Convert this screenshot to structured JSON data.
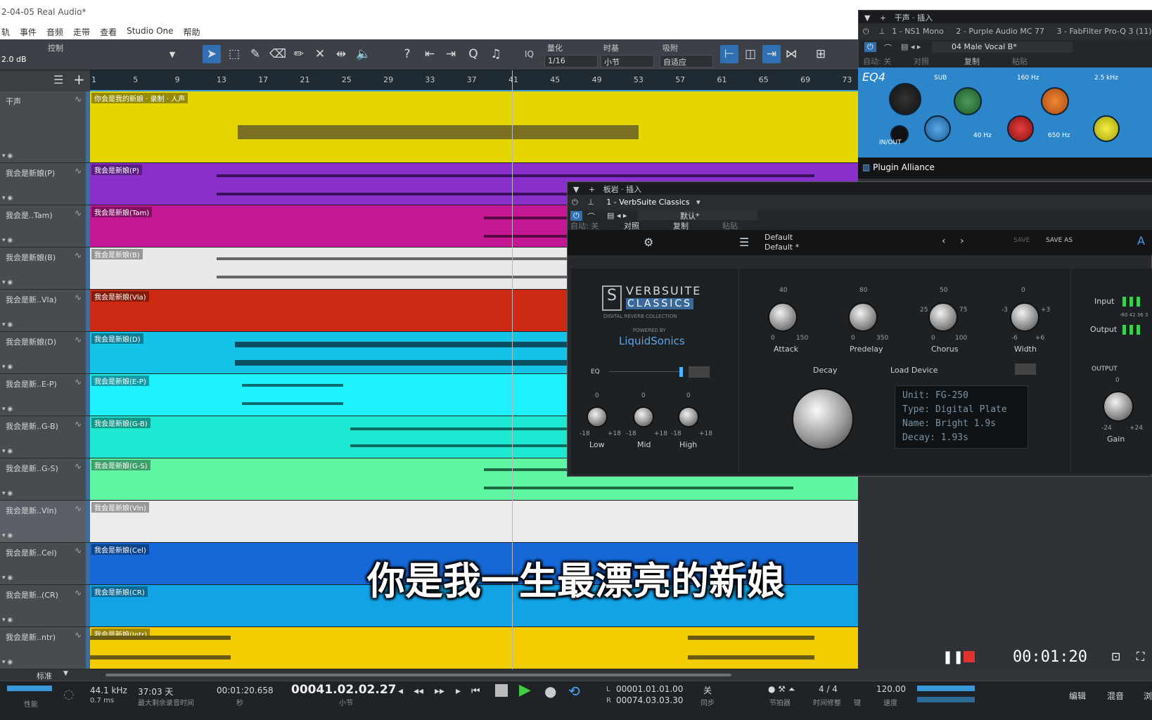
{
  "window": {
    "title": "2-04-05 Real Audio*"
  },
  "menu": [
    "轨",
    "事件",
    "音频",
    "走带",
    "查看",
    "Studio One",
    "帮助"
  ],
  "toolbar": {
    "master_label": "控制",
    "volume": "2.0 dB",
    "quantize_label": "量化",
    "quantize_value": "1/16",
    "timebase_label": "时基",
    "timebase_value": "小节",
    "snap_label": "吸附",
    "snap_value": "自适应",
    "iq": "IQ"
  },
  "ruler": {
    "ticks": [
      "1",
      "5",
      "9",
      "13",
      "17",
      "21",
      "25",
      "29",
      "33",
      "37",
      "41",
      "45",
      "49",
      "53",
      "57",
      "61",
      "65",
      "69",
      "73"
    ]
  },
  "tracks": [
    {
      "name": "干声",
      "clip": "你会是我的新娘 · 录制 · 人声",
      "color": "#e6d600",
      "wave": "#7a6f20"
    },
    {
      "name": "我会是新娘(P)",
      "clip": "我会是新娘(P)",
      "color": "#8a2fc9",
      "wave": "#3a0f5c"
    },
    {
      "name": "我会是..Tam)",
      "clip": "我会是新娘(Tam)",
      "color": "#c51795",
      "wave": "#5a0a42"
    },
    {
      "name": "我会是新娘(B)",
      "clip": "我会是新娘(B)",
      "color": "#e8e8e8",
      "wave": "#666666"
    },
    {
      "name": "我会是新..Vla)",
      "clip": "我会是新娘(Vla)",
      "color": "#cc2a12",
      "wave": "#5a1006"
    },
    {
      "name": "我会是新娘(D)",
      "clip": "我会是新娘(D)",
      "color": "#13c4e8",
      "wave": "#0a4e62"
    },
    {
      "name": "我会是新..E-P)",
      "clip": "我会是新娘(E-P)",
      "color": "#1ef2ff",
      "wave": "#0b6a72"
    },
    {
      "name": "我会是新..G-B)",
      "clip": "我会是新娘(G-B)",
      "color": "#1ee8d2",
      "wave": "#0b6a60"
    },
    {
      "name": "我会是新..G-S)",
      "clip": "我会是新娘(G-S)",
      "color": "#5ff5a2",
      "wave": "#1e6a40"
    },
    {
      "name": "我会是新..Vln)",
      "clip": "我会是新娘(Vln)",
      "color": "#ececec",
      "wave": "#777777"
    },
    {
      "name": "我会是新..Cel)",
      "clip": "我会是新娘(Cel)",
      "color": "#1568d6",
      "wave": "#0a2e62"
    },
    {
      "name": "我会是新..(CR)",
      "clip": "我会是新娘(CR)",
      "color": "#12a2e6",
      "wave": "#0a4c6a"
    },
    {
      "name": "我会是新..ntr)",
      "clip": "我会是新娘(Intr)",
      "color": "#f0cc00",
      "wave": "#6a5a10"
    }
  ],
  "subtitle": "你是我一生最漂亮的新娘",
  "eq_window": {
    "title": "干声 · 插入",
    "slots": [
      "1 - NS1 Mono",
      "2 - Purple Audio MC 77",
      "3 - FabFilter Pro-Q 3 (11)"
    ],
    "preset": "04 Male Vocal B*",
    "auto": "自动: 关",
    "compare": "对照",
    "copy": "复制",
    "paste": "粘贴",
    "plugin_name": "EQ4",
    "bands": [
      "SUB",
      "160 Hz",
      "2.5 kHz",
      "40 Hz",
      "650 Hz"
    ],
    "inout": "IN/OUT",
    "vendor": "Plugin Alliance"
  },
  "verb_window": {
    "title": "板岩 · 插入",
    "slot": "1 - VerbSuite Classics",
    "preset_sel": "默认*",
    "auto": "自动: 关",
    "compare": "对照",
    "copy": "复制",
    "paste": "粘贴",
    "preset_line1": "Default",
    "preset_line2": "Default *",
    "save": "SAVE",
    "save_as": "SAVE AS",
    "brand_line1": "VERBSUITE",
    "brand_line2": "CLASSICS",
    "brand_sub": "DIGITAL REVERB COLLECTION",
    "powered": "POWERED BY",
    "vendor": "LiquidSonics",
    "knobs": [
      {
        "label": "Attack",
        "top": "40",
        "min": "0",
        "max": "150"
      },
      {
        "label": "Predelay",
        "top": "80",
        "min": "0",
        "max": "350"
      },
      {
        "label": "Chorus",
        "top": "50",
        "min": "0",
        "max": "100"
      },
      {
        "label": "Width",
        "top": "0",
        "min": "-6",
        "max": "+6"
      }
    ],
    "eq_label": "EQ",
    "eq_knobs": [
      {
        "label": "Low",
        "top": "0",
        "min": "-18",
        "max": "+18"
      },
      {
        "label": "Mid",
        "top": "0",
        "min": "-18",
        "max": "+18"
      },
      {
        "label": "High",
        "top": "0",
        "min": "-18",
        "max": "+18"
      }
    ],
    "decay_label": "Decay",
    "load_device": "Load Device",
    "lcd": [
      "Unit:  FG-250",
      "Type:  Digital Plate",
      "Name:  Bright 1.9s",
      "Decay:  1.93s"
    ],
    "input": "Input",
    "output": "Output",
    "output_section": "OUTPUT",
    "gain": "Gain",
    "gain_top": "0",
    "gain_min": "-24",
    "gain_max": "+24",
    "width_left": "-3",
    "width_right": "+3",
    "chorus_left": "25",
    "chorus_right": "75",
    "meter_scale": "-60 42 36 3"
  },
  "recorder": {
    "time": "00:01:20"
  },
  "bottom": {
    "track_label": "标准"
  },
  "transport": {
    "perf": "性能",
    "sample_rate": "44.1 kHz",
    "latency": "0.7 ms",
    "rec_remaining": "37:03 天",
    "rec_remaining_label": "最大剩余录音时间",
    "seconds": "00:01:20.658",
    "seconds_label": "秒",
    "bars": "00041.02.02.27",
    "bars_label": "小节",
    "loop_l": "00001.01.01.00",
    "loop_r": "00074.03.03.30",
    "sync": "关",
    "sync_label": "同步",
    "metronome_label": "节拍器",
    "time_sig": "4 / 4",
    "time_sig_label": "时间修整",
    "key_label": "键",
    "tempo": "120.00",
    "tempo_label": "速度",
    "edit": "编辑",
    "mix": "混音",
    "browse": "浏"
  }
}
